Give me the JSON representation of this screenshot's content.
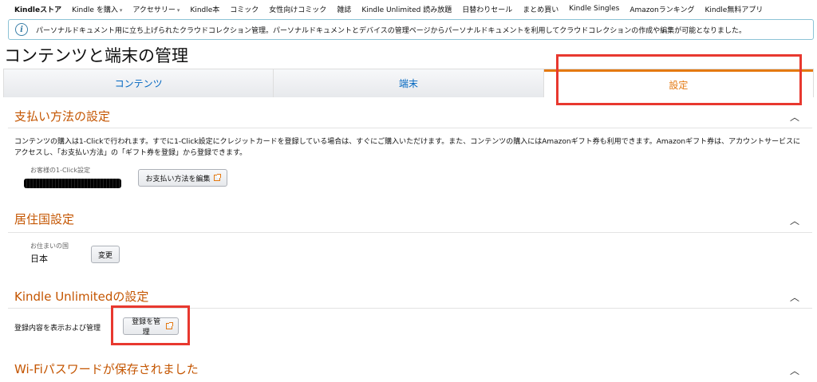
{
  "topnav": {
    "items": [
      {
        "label": "Kindleストア",
        "bold": true
      },
      {
        "label": "Kindle を購入",
        "caret": true
      },
      {
        "label": "アクセサリー",
        "caret": true
      },
      {
        "label": "Kindle本"
      },
      {
        "label": "コミック"
      },
      {
        "label": "女性向けコミック"
      },
      {
        "label": "雑誌"
      },
      {
        "label": "Kindle Unlimited 読み放題"
      },
      {
        "label": "日替わりセール"
      },
      {
        "label": "まとめ買い"
      },
      {
        "label": "Kindle Singles"
      },
      {
        "label": "Amazonランキング"
      },
      {
        "label": "Kindle無料アプリ"
      }
    ],
    "caret_glyph": "▾"
  },
  "info": {
    "icon": "info-icon",
    "icon_glyph": "i",
    "text": "パーソナルドキュメント用に立ち上げられたクラウドコレクション管理。パーソナルドキュメントとデバイスの管理ページからパーソナルドキュメントを利用してクラウドコレクションの作成や編集が可能となりました。"
  },
  "page": {
    "title": "コンテンツと端末の管理"
  },
  "tabs": [
    {
      "label": "コンテンツ",
      "active": false
    },
    {
      "label": "端末",
      "active": false
    },
    {
      "label": "設定",
      "active": true
    }
  ],
  "colors": {
    "accent": "#e47911",
    "link": "#0066c0",
    "section_title": "#c45500",
    "highlight": "#e8382f"
  },
  "chevron_glyph": "︿",
  "payment": {
    "title": "支払い方法の設定",
    "description": "コンテンツの購入は1-Clickで行われます。すでに1-Click設定にクレジットカードを登録している場合は、すぐにご購入いただけます。また、コンテンツの購入にはAmazonギフト券も利用できます。Amazonギフト券は、アカウントサービスにアクセスし、「お支払い方法」の「ギフト券を登録」から登録できます。",
    "oneclick_label": "お客様の1-Click設定",
    "edit_button": "お支払い方法を編集"
  },
  "residence": {
    "title": "居住国設定",
    "country_label": "お住まいの国",
    "country_value": "日本",
    "change_button": "変更"
  },
  "unlimited": {
    "title": "Kindle Unlimitedの設定",
    "manage_text": "登録内容を表示および管理",
    "manage_button": "登録を管理"
  },
  "wifi": {
    "title": "Wi-Fiパスワードが保存されました"
  }
}
